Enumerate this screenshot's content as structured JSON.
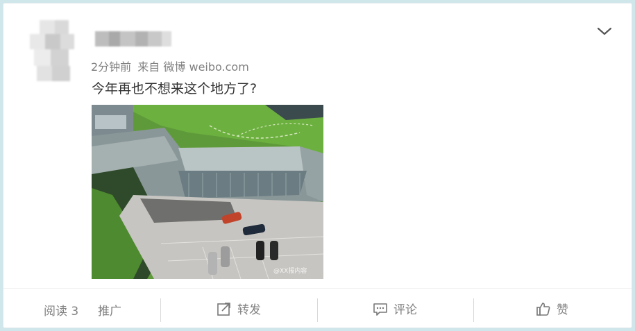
{
  "post": {
    "time": "2分钟前",
    "source_prefix": "来自",
    "source": "微博 weibo.com",
    "text": "今年再也不想来这个地方了?",
    "watermark": "@XX报内容"
  },
  "footer": {
    "read_label": "阅读 3",
    "promote_label": "推广",
    "repost_label": "转发",
    "comment_label": "评论",
    "like_label": "赞"
  },
  "icons": {
    "menu": "chevron-down-icon",
    "repost": "share-icon",
    "comment": "comment-icon",
    "like": "thumbs-up-icon"
  },
  "colors": {
    "meta_text": "#808080",
    "body_text": "#333333",
    "page_bg": "#cfe6ea"
  }
}
